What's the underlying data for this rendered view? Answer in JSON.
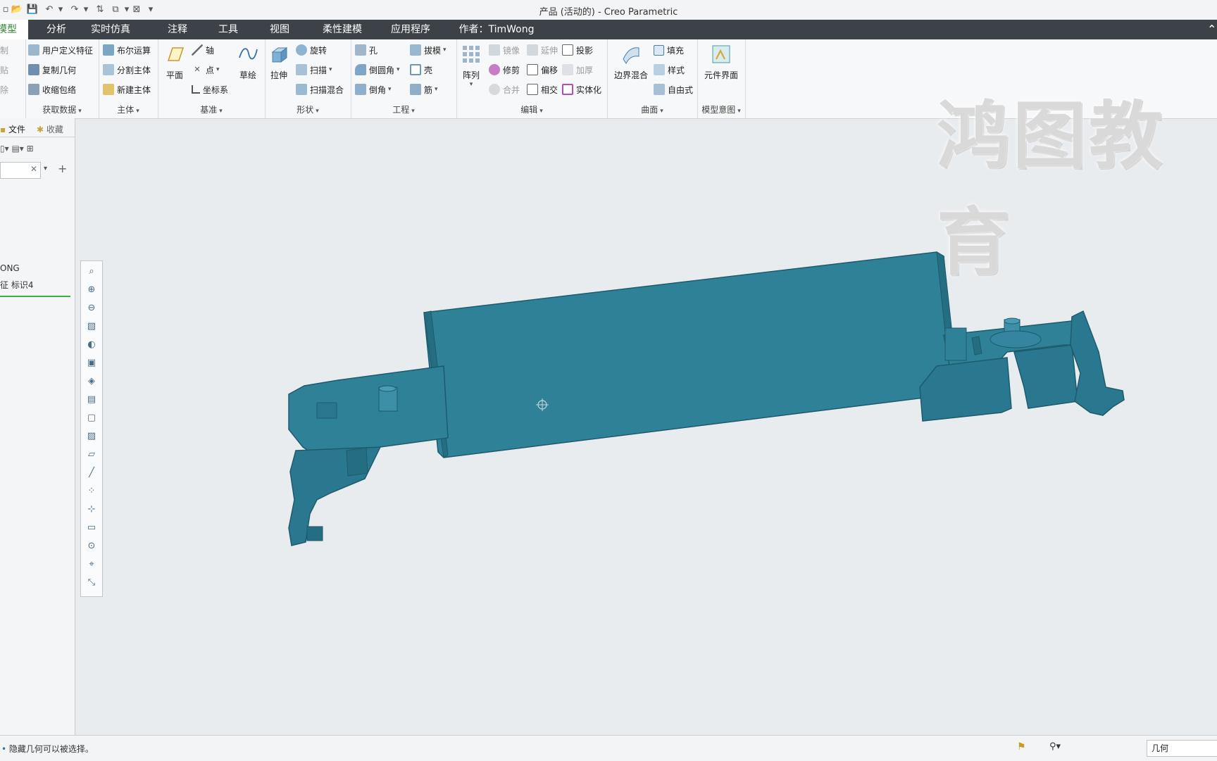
{
  "window": {
    "title": "产品 (活动的) - Creo Parametric"
  },
  "tabs": [
    {
      "label": "模型",
      "active": true
    },
    {
      "label": "分析"
    },
    {
      "label": "实时仿真"
    },
    {
      "label": "注释"
    },
    {
      "label": "工具"
    },
    {
      "label": "视图"
    },
    {
      "label": "柔性建模"
    },
    {
      "label": "应用程序"
    },
    {
      "label": "作者：TimWong"
    }
  ],
  "ribbon": {
    "ops": {
      "items": [
        "制",
        "贴",
        "除"
      ]
    },
    "get_data": {
      "label": "获取数据",
      "items": [
        "用户定义特征",
        "复制几何",
        "收缩包络"
      ]
    },
    "body": {
      "label": "主体",
      "items": [
        "布尔运算",
        "分割主体",
        "新建主体"
      ]
    },
    "datum": {
      "label": "基准",
      "plane": "平面",
      "axis": "轴",
      "point": "点",
      "csys": "坐标系",
      "sketch": "草绘"
    },
    "shapes": {
      "label": "形状",
      "extrude": "拉伸",
      "revolve": "旋转",
      "sweep": "扫描",
      "swept_blend": "扫描混合"
    },
    "engineering": {
      "label": "工程",
      "hole": "孔",
      "round": "倒圆角",
      "chamfer": "倒角",
      "draft": "拔模",
      "shell": "壳",
      "rib": "筋"
    },
    "editing": {
      "label": "编辑",
      "pattern": "阵列",
      "mirror": "镜像",
      "trim": "修剪",
      "merge": "合并",
      "extend": "延伸",
      "offset": "偏移",
      "intersect": "相交",
      "project": "投影",
      "thicken": "加厚",
      "solidify": "实体化"
    },
    "surfaces": {
      "label": "曲面",
      "boundary_blend": "边界混合",
      "fill": "填充",
      "style": "样式",
      "freestyle": "自由式"
    },
    "model_intent": {
      "label": "模型意图",
      "component_interface": "元件界面"
    }
  },
  "left_panel": {
    "tab_file": "文件",
    "tab_favorites": "收藏",
    "tree_items": [
      "ONG",
      "征 标识4"
    ]
  },
  "status": {
    "message": "隐藏几何可以被选择。",
    "filter_value": "几何"
  },
  "watermark": "鸿图教育",
  "colors": {
    "model": "#2f8198",
    "model_dark": "#1c5b6c",
    "tabbar": "#3d4148",
    "active_tab_text": "#2a8a2a"
  },
  "icons": {
    "vertical_toolbar": [
      "zoom-fit-icon",
      "zoom-in-icon",
      "zoom-out-icon",
      "repaint-icon",
      "spin-center-icon",
      "display-style-icon",
      "saved-orientations-icon",
      "view-manager-icon",
      "section-icon",
      "annotation-display-icon",
      "plane-display-icon",
      "axis-display-icon",
      "point-display-icon",
      "csys-display-icon",
      "tag-display-icon",
      "spin-center-display-icon",
      "annotation-icon",
      "reference-icon"
    ]
  }
}
